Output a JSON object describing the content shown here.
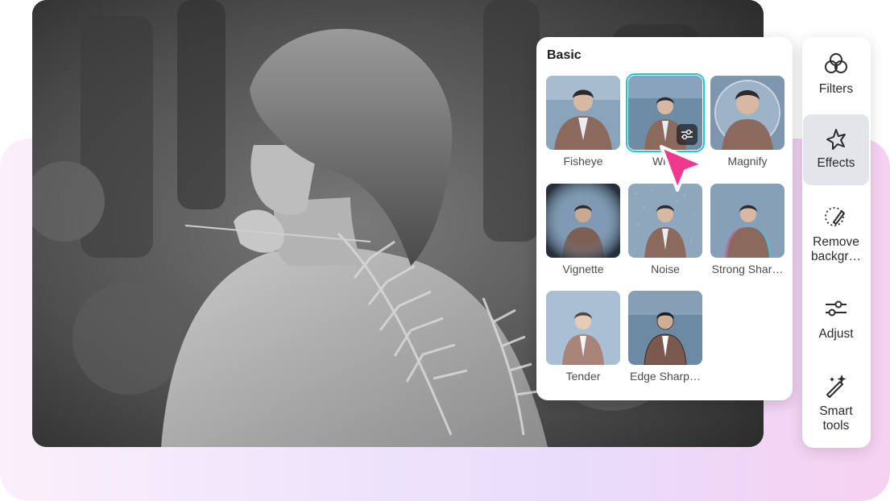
{
  "effects_panel": {
    "section_title": "Basic",
    "effects": [
      {
        "label": "Fisheye",
        "selected": false
      },
      {
        "label": "Wide",
        "selected": true
      },
      {
        "label": "Magnify",
        "selected": false
      },
      {
        "label": "Vignette",
        "selected": false
      },
      {
        "label": "Noise",
        "selected": false
      },
      {
        "label": "Strong Shar…",
        "selected": false
      },
      {
        "label": "Tender",
        "selected": false
      },
      {
        "label": "Edge Sharp…",
        "selected": false
      }
    ]
  },
  "toolbar": {
    "active_tool": "Effects",
    "tools": [
      {
        "label": "Filters",
        "icon": "filters-icon"
      },
      {
        "label": "Effects",
        "icon": "effects-icon"
      },
      {
        "label": "Remove backgr…",
        "icon": "remove-background-icon"
      },
      {
        "label": "Adjust",
        "icon": "adjust-icon"
      },
      {
        "label": "Smart tools",
        "icon": "smart-tools-icon"
      }
    ]
  },
  "colors": {
    "selection_outline": "#1fc5d8",
    "cursor": "#f0388f",
    "active_tool_bg": "#e3e5ea"
  }
}
